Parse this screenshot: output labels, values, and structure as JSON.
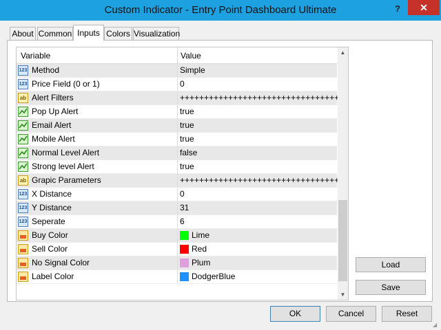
{
  "window": {
    "title": "Custom Indicator - Entry Point Dashboard Ultimate",
    "help_label": "?",
    "close_label": "✕"
  },
  "tabs": [
    {
      "label": "About"
    },
    {
      "label": "Common"
    },
    {
      "label": "Inputs",
      "active": true
    },
    {
      "label": "Colors"
    },
    {
      "label": "Visualization"
    }
  ],
  "grid": {
    "headers": {
      "variable": "Variable",
      "value": "Value"
    },
    "rows": [
      {
        "icon": "number-icon",
        "variable": "Method",
        "value": "Simple"
      },
      {
        "icon": "number-icon",
        "variable": "Price Field (0 or 1)",
        "value": "0"
      },
      {
        "icon": "string-icon",
        "variable": "Alert Filters",
        "value": "++++++++++++++++++++++++++++++++++"
      },
      {
        "icon": "bool-icon",
        "variable": "Pop Up Alert",
        "value": "true"
      },
      {
        "icon": "bool-icon",
        "variable": "Email Alert",
        "value": "true"
      },
      {
        "icon": "bool-icon",
        "variable": "Mobile Alert",
        "value": "true"
      },
      {
        "icon": "bool-icon",
        "variable": "Normal Level Alert",
        "value": "false"
      },
      {
        "icon": "bool-icon",
        "variable": "Strong level Alert",
        "value": "true"
      },
      {
        "icon": "string-icon",
        "variable": "Grapic Parameters",
        "value": "++++++++++++++++++++++++++++++++++"
      },
      {
        "icon": "number-icon",
        "variable": "X Distance",
        "value": "0"
      },
      {
        "icon": "number-icon",
        "variable": "Y Distance",
        "value": "31"
      },
      {
        "icon": "number-icon",
        "variable": "Seperate",
        "value": "6"
      },
      {
        "icon": "color-icon",
        "variable": "Buy Color",
        "value": "Lime",
        "color": "#00ff00"
      },
      {
        "icon": "color-icon",
        "variable": "Sell Color",
        "value": "Red",
        "color": "#ff0000"
      },
      {
        "icon": "color-icon",
        "variable": "No Signal Color",
        "value": "Plum",
        "color": "#dda0dd"
      },
      {
        "icon": "color-icon",
        "variable": "Label Color",
        "value": "DodgerBlue",
        "color": "#1e90ff"
      }
    ]
  },
  "scrollbar": {
    "up_icon": "▲",
    "down_icon": "▼"
  },
  "buttons": {
    "load": "Load",
    "save": "Save",
    "ok": "OK",
    "cancel": "Cancel",
    "reset": "Reset"
  },
  "colors": {
    "titlebar": "#1da1e0",
    "close": "#c6312a"
  }
}
